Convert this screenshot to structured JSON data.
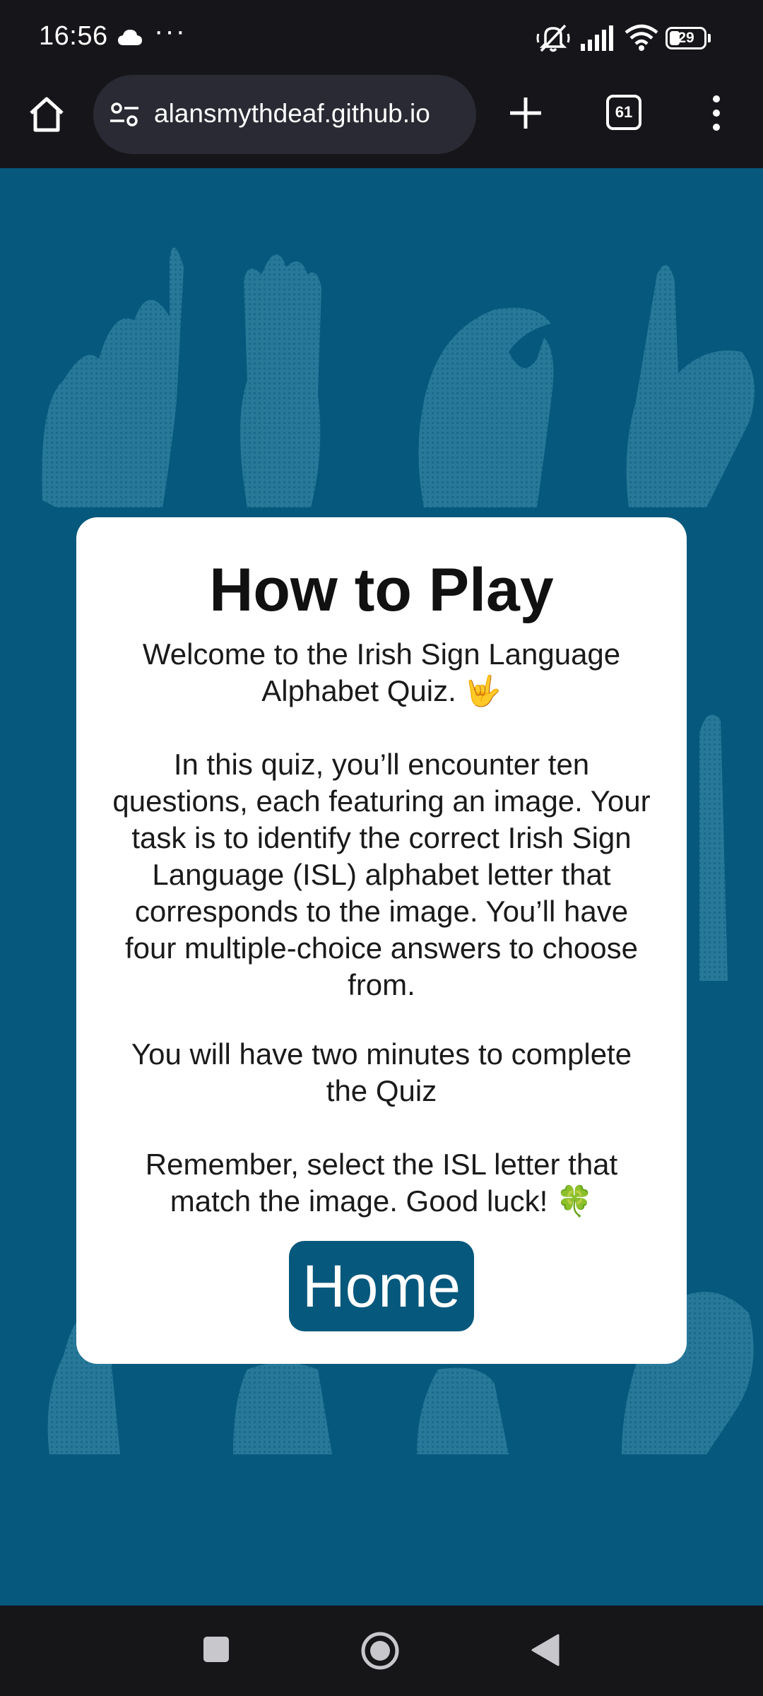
{
  "status_bar": {
    "time": "16:56",
    "overflow": "···",
    "battery_level": "29",
    "icons": [
      "cloud-icon",
      "mute-icon",
      "signal-icon",
      "wifi-icon",
      "battery-icon"
    ]
  },
  "browser": {
    "url": "alansmythdeaf.github.io",
    "tab_count": "61",
    "icons": [
      "home-icon",
      "site-settings-icon",
      "new-tab-icon",
      "tab-switcher-icon",
      "menu-icon"
    ]
  },
  "page": {
    "background_color": "#06587c",
    "accent_color": "#06587c"
  },
  "modal": {
    "title": "How to Play",
    "paragraph1": "Welcome to the Irish Sign Language Alphabet Quiz. 🤟",
    "paragraph2": "In this quiz, you’ll encounter ten questions, each featuring an image. Your task is to identify the correct Irish Sign Language (ISL) alphabet letter that corresponds to the image. You’ll have four multiple-choice answers to choose from.",
    "paragraph3": "You will have two minutes to complete the Quiz",
    "paragraph4": "Remember, select the ISL letter that match the image. Good luck! 🍀",
    "home_button": "Home"
  },
  "nav_bar": {
    "icons": [
      "recents-icon",
      "home-circle-icon",
      "back-icon"
    ]
  }
}
